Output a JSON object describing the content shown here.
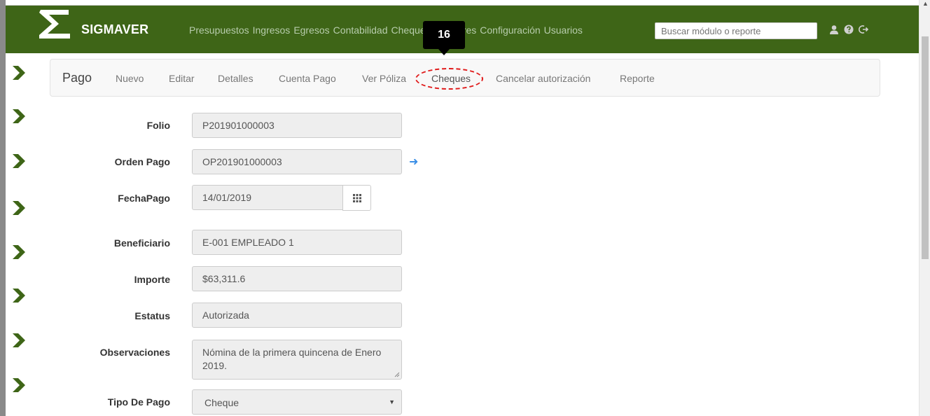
{
  "brand": {
    "name": "SIGMAVER"
  },
  "menu": [
    "Presupuestos",
    "Ingresos",
    "Egresos",
    "Contabilidad",
    "Cheques",
    "Auxiliares",
    "Configuración",
    "Usuarios"
  ],
  "search": {
    "placeholder": "Buscar módulo o reporte"
  },
  "icons": {
    "user": "user-icon",
    "help": "question-icon",
    "logout": "logout-icon",
    "calendar": "calendar-grid-icon",
    "link": "arrow-right-icon",
    "side": "chevron-right-icon"
  },
  "colors": {
    "navbar": "#3e6517",
    "accent": "#3a8ee6",
    "highlight": "#e01b1b"
  },
  "callout": {
    "number": "16"
  },
  "subnav": {
    "title": "Pago",
    "items": [
      "Nuevo",
      "Editar",
      "Detalles",
      "Cuenta Pago",
      "Ver Póliza",
      "Cheques",
      "Cancelar autorización",
      "Reporte"
    ]
  },
  "form": {
    "folio": {
      "label": "Folio",
      "value": "P201901000003"
    },
    "orden_pago": {
      "label": "Orden Pago",
      "value": "OP201901000003"
    },
    "fecha_pago": {
      "label": "FechaPago",
      "value": "14/01/2019"
    },
    "beneficiario": {
      "label": "Beneficiario",
      "value": "E-001 EMPLEADO 1"
    },
    "importe": {
      "label": "Importe",
      "value": "$63,311.6"
    },
    "estatus": {
      "label": "Estatus",
      "value": "Autorizada"
    },
    "observaciones": {
      "label": "Observaciones",
      "value": "Nómina de la primera quincena de Enero 2019."
    },
    "tipo_pago": {
      "label": "Tipo De Pago",
      "value": "Cheque"
    }
  }
}
